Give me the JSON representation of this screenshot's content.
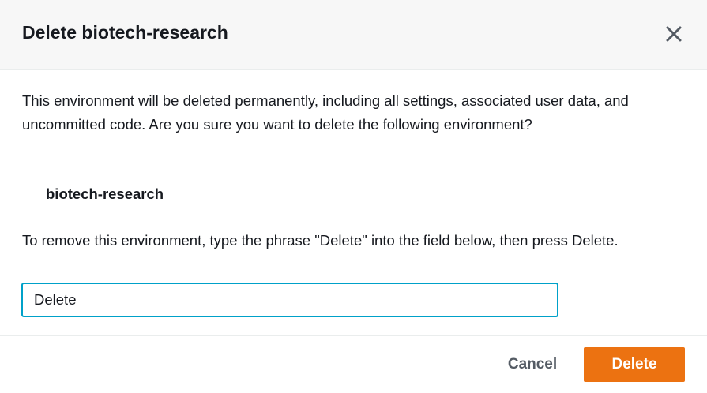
{
  "modal": {
    "title": "Delete biotech-research",
    "close_icon": "close-icon",
    "message": "This environment will be deleted permanently, including all settings, associated user data, and uncommitted code. Are you sure you want to delete the following environment?",
    "environment_name": "biotech-research",
    "instruction": "To remove this environment, type the phrase \"Delete\" into the field below, then press Delete.",
    "confirm_input_value": "Delete",
    "cancel_label": "Cancel",
    "delete_label": "Delete"
  },
  "colors": {
    "primary_button": "#ec7211",
    "input_focus_border": "#00a1c9",
    "cancel_text": "#545b64"
  }
}
